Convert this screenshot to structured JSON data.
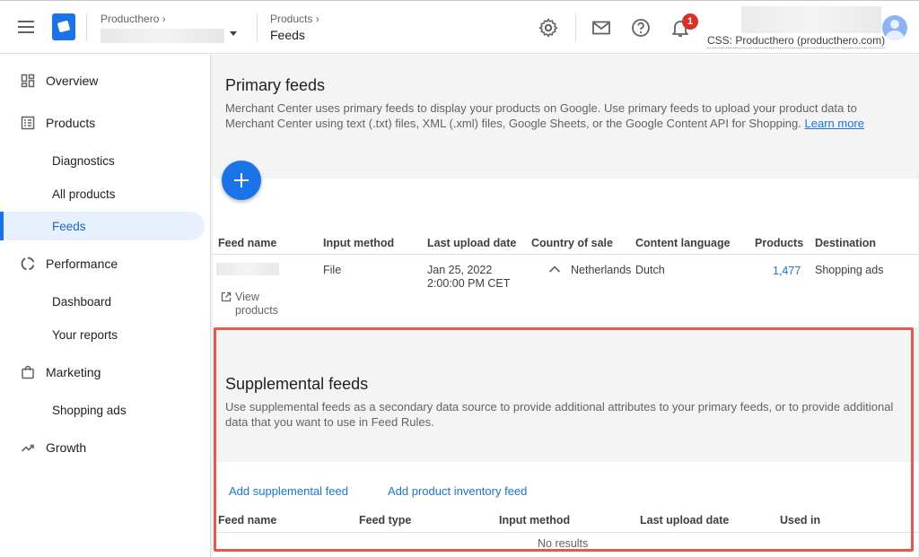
{
  "header": {
    "account_label": "Producthero",
    "breadcrumb_parent": "Products",
    "breadcrumb_current": "Feeds",
    "notification_count": "1",
    "css_label": "CSS: Producthero (producthero.com)"
  },
  "icons": {
    "menu": "hamburger-icon",
    "logo": "merchant-center-logo",
    "settings": "gear-icon",
    "mail": "mail-icon",
    "help": "help-icon",
    "notifications": "bell-icon"
  },
  "sidebar": {
    "items": [
      {
        "label": "Overview",
        "icon": "dashboard-icon"
      },
      {
        "label": "Products",
        "icon": "list-icon"
      },
      {
        "label": "Diagnostics"
      },
      {
        "label": "All products"
      },
      {
        "label": "Feeds"
      },
      {
        "label": "Performance",
        "icon": "performance-icon"
      },
      {
        "label": "Dashboard"
      },
      {
        "label": "Your reports"
      },
      {
        "label": "Marketing",
        "icon": "shopping-bag-icon"
      },
      {
        "label": "Shopping ads"
      },
      {
        "label": "Growth",
        "icon": "trending-up-icon"
      }
    ]
  },
  "primary": {
    "title": "Primary feeds",
    "description": "Merchant Center uses primary feeds to display your products on Google. Use primary feeds to upload your product data to Merchant Center using text (.txt) files, XML (.xml) files, Google Sheets, or the Google Content API for Shopping.",
    "learn_more": "Learn more",
    "columns": [
      "Feed name",
      "Input method",
      "Last upload date",
      "Country of sale",
      "Content language",
      "Products",
      "Destination"
    ],
    "row": {
      "input_method": "File",
      "upload_date": "Jan 25, 2022",
      "upload_time": "2:00:00 PM CET",
      "country": "Netherlands",
      "language": "Dutch",
      "products": "1,477",
      "destination": "Shopping ads",
      "view_products": "View products"
    }
  },
  "supplemental": {
    "title": "Supplemental feeds",
    "description": "Use supplemental feeds as a secondary data source to provide additional attributes to your primary feeds, or to provide additional data that you want to use in Feed Rules.",
    "add_supplemental": "Add supplemental feed",
    "add_inventory": "Add product inventory feed",
    "columns": [
      "Feed name",
      "Feed type",
      "Input method",
      "Last upload date",
      "Used in"
    ],
    "empty": "No results"
  },
  "colors": {
    "accent": "#1a73e8",
    "highlight": "#e8574a",
    "badge": "#d93025"
  }
}
